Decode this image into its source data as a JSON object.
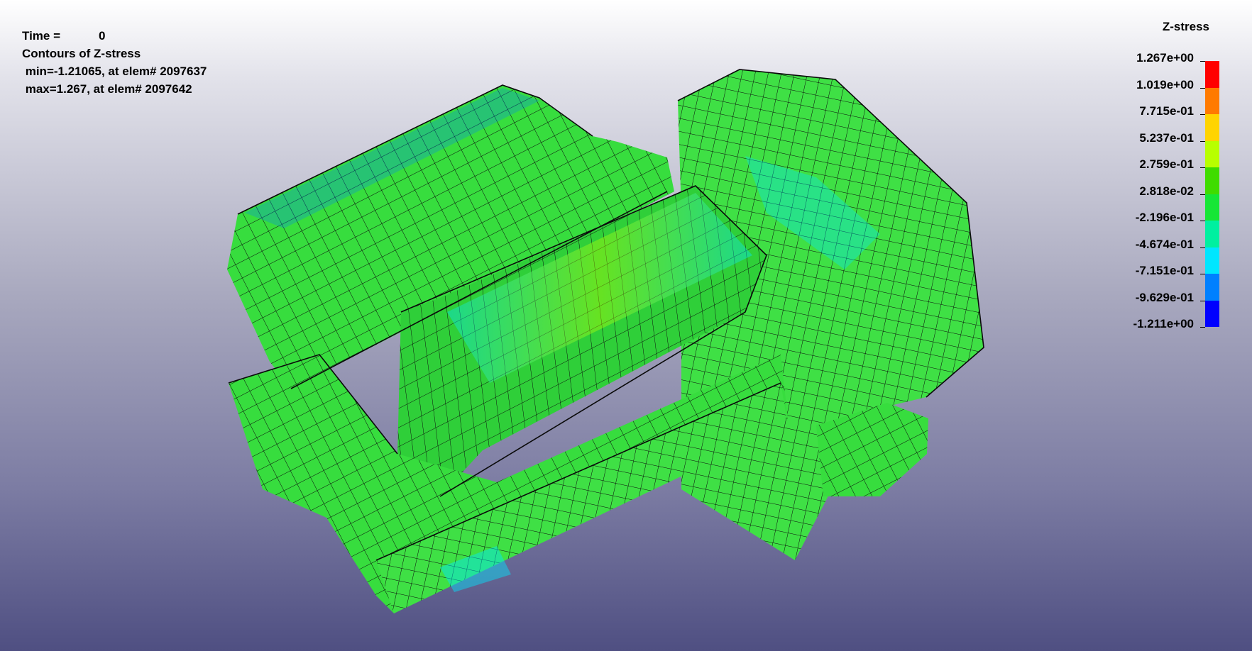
{
  "info": {
    "time_label": "Time =",
    "time_value": "0",
    "contour_title": "Contours of Z-stress",
    "min_line": " min=-1.21065, at elem# 2097637",
    "max_line": " max=1.267, at elem# 2097642"
  },
  "legend": {
    "title": "Z-stress",
    "labels": [
      "1.267e+00",
      "1.019e+00",
      "7.715e-01",
      "5.237e-01",
      "2.759e-01",
      "2.818e-02",
      "-2.196e-01",
      "-4.674e-01",
      "-7.151e-01",
      "-9.629e-01",
      "-1.211e+00"
    ],
    "colors": [
      "#ff0000",
      "#ff7a00",
      "#ffd400",
      "#b8ff00",
      "#3fdc00",
      "#16e636",
      "#00f0a0",
      "#00e6ff",
      "#0080ff",
      "#0000ff"
    ]
  },
  "mesh": {
    "element_color": "#2fe03a",
    "edge_color": "#111111",
    "highlight_colors": [
      "#00e6ff",
      "#0080ff",
      "#b8ff00"
    ]
  }
}
